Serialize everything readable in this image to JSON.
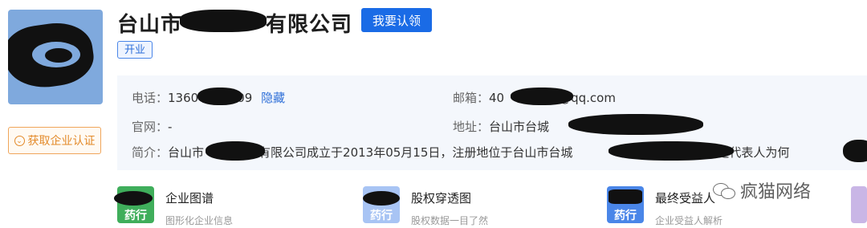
{
  "company": {
    "name_prefix": "台山市",
    "name_suffix": "有限公司",
    "claim_label": "我要认领",
    "status": "开业",
    "cert_label": "获取企业认证"
  },
  "info": {
    "phone_label": "电话：",
    "phone_start": "1360",
    "phone_end": "09",
    "phone_hide": "隐藏",
    "email_label": "邮箱：",
    "email_start": "40",
    "email_end": "@qq.com",
    "website_label": "官网：",
    "website_value": "-",
    "address_label": "地址：",
    "address_value": "台山市台城",
    "intro_label": "简介：",
    "intro_a": "台山市",
    "intro_b": "有限公司成立于2013年05月15日，注册地位于台山市台城",
    "intro_c": "，法定代表人为何"
  },
  "cards": [
    {
      "title": "企业图谱",
      "sub": "图形化企业信息",
      "tag": "药行",
      "color": "#3fae5b"
    },
    {
      "title": "股权穿透图",
      "sub": "股权数据一目了然",
      "tag": "药行",
      "color": "#5b8ef0"
    },
    {
      "title": "最终受益人",
      "sub": "企业受益人解析",
      "tag": "药行",
      "color": "#4a86e8"
    }
  ],
  "watermark": "疯猫网络"
}
